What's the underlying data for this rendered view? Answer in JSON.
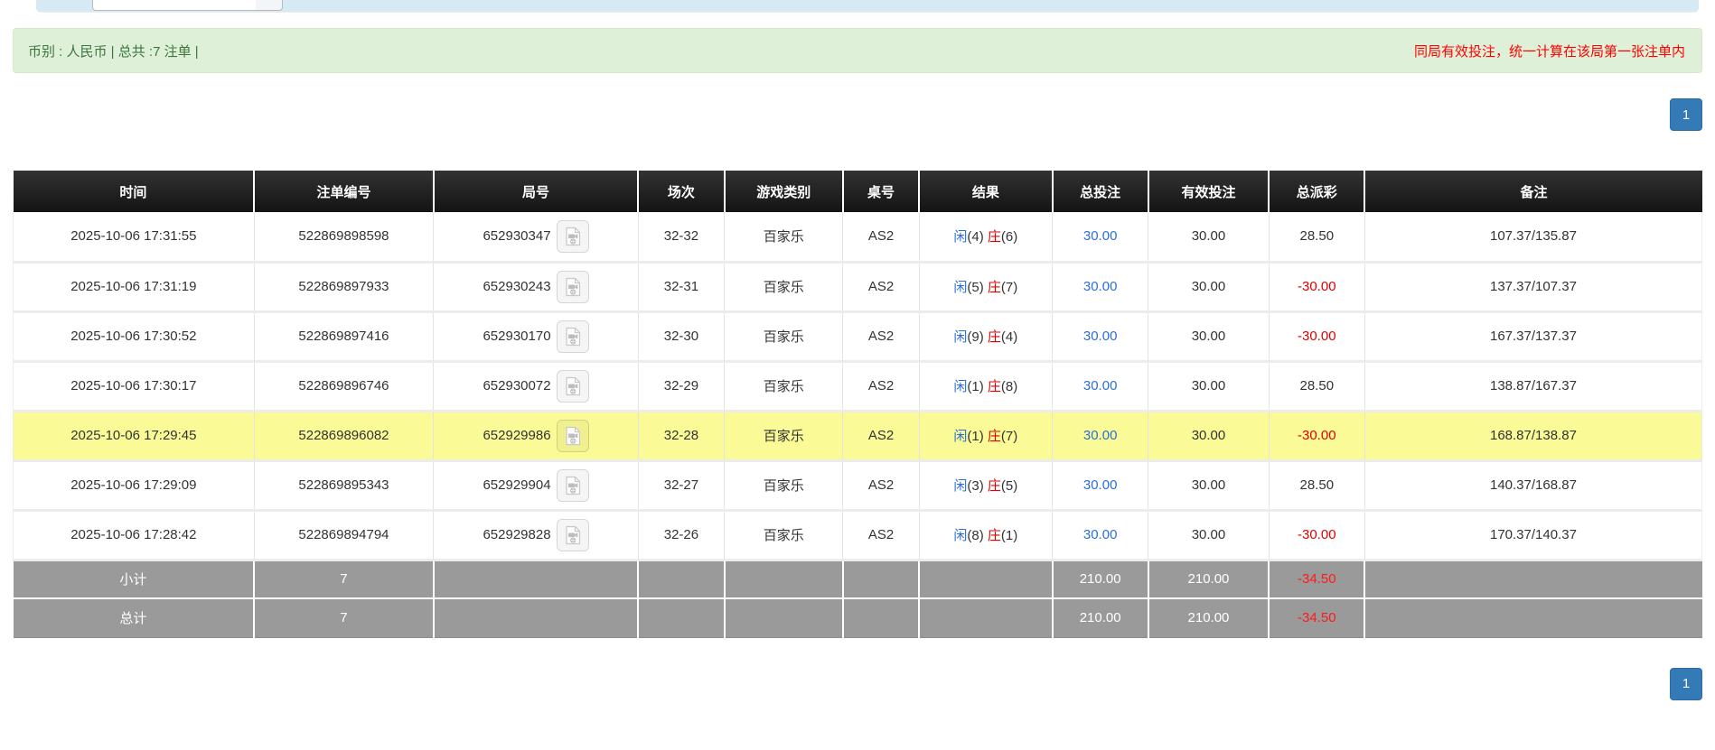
{
  "top_bar": {
    "input_value": ""
  },
  "info_bar": {
    "summary": "币别 : 人民币 | 总共 :7 注单 |",
    "note": "同局有效投注，统一计算在该局第一张注单内"
  },
  "pagination": {
    "page": "1"
  },
  "colors": {
    "accent_blue": "#337ab7",
    "link_blue": "#2b6ed9",
    "loss_red": "#e00000",
    "highlight_yellow": "#fafa96",
    "totals_gray": "#9a9a9a",
    "info_green_bg": "#dff0d8",
    "info_green_text": "#3c763d"
  },
  "table": {
    "headers": [
      "时间",
      "注单编号",
      "局号",
      "场次",
      "游戏类别",
      "桌号",
      "结果",
      "总投注",
      "有效投注",
      "总派彩",
      "备注"
    ],
    "result_labels": {
      "player": "闲",
      "banker": "庄"
    },
    "icons": {
      "round_video": "video-icon"
    },
    "rows": [
      {
        "time": "2025-10-06 17:31:55",
        "bet_id": "522869898598",
        "round_id": "652930347",
        "session": "32-32",
        "game_type": "百家乐",
        "table_no": "AS2",
        "result": {
          "player": "4",
          "banker": "6"
        },
        "total_bet": "30.00",
        "valid_bet": "30.00",
        "payout": "28.50",
        "remark": "107.37/135.87",
        "highlighted": false
      },
      {
        "time": "2025-10-06 17:31:19",
        "bet_id": "522869897933",
        "round_id": "652930243",
        "session": "32-31",
        "game_type": "百家乐",
        "table_no": "AS2",
        "result": {
          "player": "5",
          "banker": "7"
        },
        "total_bet": "30.00",
        "valid_bet": "30.00",
        "payout": "-30.00",
        "remark": "137.37/107.37",
        "highlighted": false
      },
      {
        "time": "2025-10-06 17:30:52",
        "bet_id": "522869897416",
        "round_id": "652930170",
        "session": "32-30",
        "game_type": "百家乐",
        "table_no": "AS2",
        "result": {
          "player": "9",
          "banker": "4"
        },
        "total_bet": "30.00",
        "valid_bet": "30.00",
        "payout": "-30.00",
        "remark": "167.37/137.37",
        "highlighted": false
      },
      {
        "time": "2025-10-06 17:30:17",
        "bet_id": "522869896746",
        "round_id": "652930072",
        "session": "32-29",
        "game_type": "百家乐",
        "table_no": "AS2",
        "result": {
          "player": "1",
          "banker": "8"
        },
        "total_bet": "30.00",
        "valid_bet": "30.00",
        "payout": "28.50",
        "remark": "138.87/167.37",
        "highlighted": false
      },
      {
        "time": "2025-10-06 17:29:45",
        "bet_id": "522869896082",
        "round_id": "652929986",
        "session": "32-28",
        "game_type": "百家乐",
        "table_no": "AS2",
        "result": {
          "player": "1",
          "banker": "7"
        },
        "total_bet": "30.00",
        "valid_bet": "30.00",
        "payout": "-30.00",
        "remark": "168.87/138.87",
        "highlighted": true
      },
      {
        "time": "2025-10-06 17:29:09",
        "bet_id": "522869895343",
        "round_id": "652929904",
        "session": "32-27",
        "game_type": "百家乐",
        "table_no": "AS2",
        "result": {
          "player": "3",
          "banker": "5"
        },
        "total_bet": "30.00",
        "valid_bet": "30.00",
        "payout": "28.50",
        "remark": "140.37/168.87",
        "highlighted": false
      },
      {
        "time": "2025-10-06 17:28:42",
        "bet_id": "522869894794",
        "round_id": "652929828",
        "session": "32-26",
        "game_type": "百家乐",
        "table_no": "AS2",
        "result": {
          "player": "8",
          "banker": "1"
        },
        "total_bet": "30.00",
        "valid_bet": "30.00",
        "payout": "-30.00",
        "remark": "170.37/140.37",
        "highlighted": false
      }
    ],
    "subtotal": {
      "label": "小计",
      "count": "7",
      "total_bet": "210.00",
      "valid_bet": "210.00",
      "payout": "-34.50",
      "remark": ""
    },
    "grand_total": {
      "label": "总计",
      "count": "7",
      "total_bet": "210.00",
      "valid_bet": "210.00",
      "payout": "-34.50",
      "remark": ""
    }
  }
}
